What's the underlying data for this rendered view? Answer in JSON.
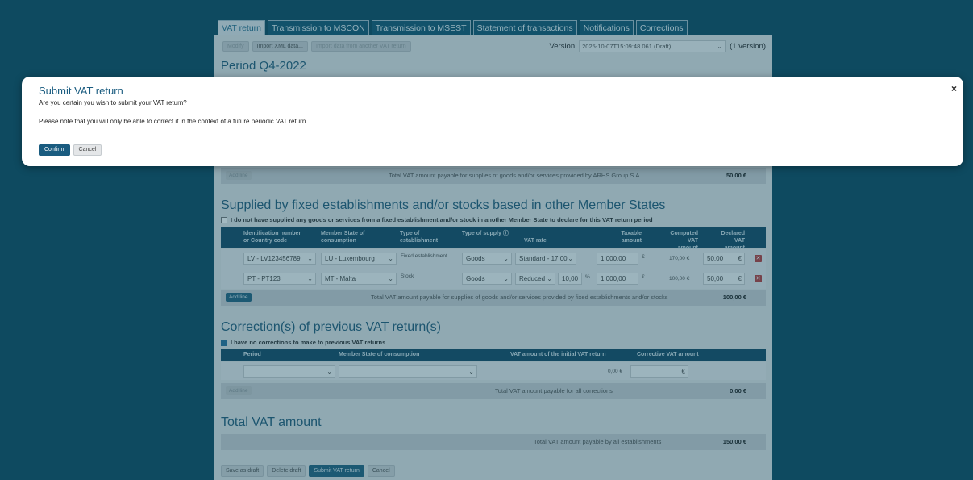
{
  "tabs": [
    {
      "label": "VAT return",
      "active": true
    },
    {
      "label": "Transmission to MSCON",
      "active": false
    },
    {
      "label": "Transmission to MSEST",
      "active": false
    },
    {
      "label": "Statement of transactions",
      "active": false
    },
    {
      "label": "Notifications",
      "active": false
    },
    {
      "label": "Corrections",
      "active": false
    }
  ],
  "toolbar": {
    "modify": "Modify",
    "import_xml": "Import XML data...",
    "import_other": "Import data from another VAT return",
    "version_label": "Version",
    "version_value": "2025-10-07T15:09:48.061 (Draft)",
    "version_count": "(1 version)"
  },
  "period_title": "Period Q4-2022",
  "first_section": {
    "add_line": "Add line",
    "total_label": "Total VAT amount payable for supplies of goods and/or services provided by ARHS Group S.A.",
    "total_amount": "50,00 €"
  },
  "fixed_section": {
    "title": "Supplied by fixed establishments and/or stocks based in other Member States",
    "checkbox_label": "I do not have supplied any goods or services from a fixed establishment and/or stock in another Member State to declare for this VAT return period",
    "headers": {
      "id": "Identification number or Country code",
      "msc": "Member State of consumption",
      "estab": "Type of establishment",
      "supply": "Type of supply",
      "rate": "VAT rate",
      "taxable": "Taxable amount",
      "computed": "Computed VAT amount",
      "declared": "Declared VAT amount"
    },
    "rows": [
      {
        "id": "LV - LV123456789",
        "msc": "LU - Luxembourg",
        "estab": "Fixed establishment",
        "supply": "Goods",
        "rate": "Standard - 17.00",
        "rate_pct": "",
        "taxable": "1 000,00",
        "computed": "170,00",
        "declared": "50,00"
      },
      {
        "id": "PT - PT123",
        "msc": "MT - Malta",
        "estab": "Stock",
        "supply": "Goods",
        "rate": "Reduced",
        "rate_pct": "10,00",
        "taxable": "1 000,00",
        "computed": "100,00",
        "declared": "50,00"
      }
    ],
    "add_line": "Add line",
    "total_label": "Total VAT amount payable for supplies of goods and/or services provided by fixed establishments and/or stocks",
    "total_amount": "100,00 €"
  },
  "corrections_section": {
    "title": "Correction(s) of previous VAT return(s)",
    "checkbox_label": "I have no corrections to make to previous VAT returns",
    "headers": {
      "period": "Period",
      "msc": "Member State of consumption",
      "initial": "VAT amount of the initial VAT return",
      "corrective": "Corrective VAT amount"
    },
    "row": {
      "initial": "0,00",
      "corrective": ""
    },
    "add_line": "Add line",
    "total_label": "Total VAT amount payable for all corrections",
    "total_amount": "0,00 €"
  },
  "total_section": {
    "title": "Total VAT amount",
    "total_label": "Total VAT amount payable by all establishments",
    "total_amount": "150,00 €"
  },
  "footer": {
    "save_draft": "Save as draft",
    "delete_draft": "Delete draft",
    "submit": "Submit VAT return",
    "cancel": "Cancel"
  },
  "modal": {
    "title": "Submit VAT return",
    "question": "Are you certain you wish to submit your VAT return?",
    "note": "Please note that you will only be able to correct it in the context of a future periodic VAT return.",
    "confirm": "Confirm",
    "cancel": "Cancel",
    "close_glyph": "×"
  },
  "symbols": {
    "euro": "€",
    "percent": "%",
    "chevron": "⌄",
    "delete": "✕",
    "info": "ⓘ"
  },
  "colors": {
    "background": "#0e4a60",
    "accent": "#1a5c80",
    "header": "#0f4d6b",
    "delete": "#c73a3a"
  }
}
